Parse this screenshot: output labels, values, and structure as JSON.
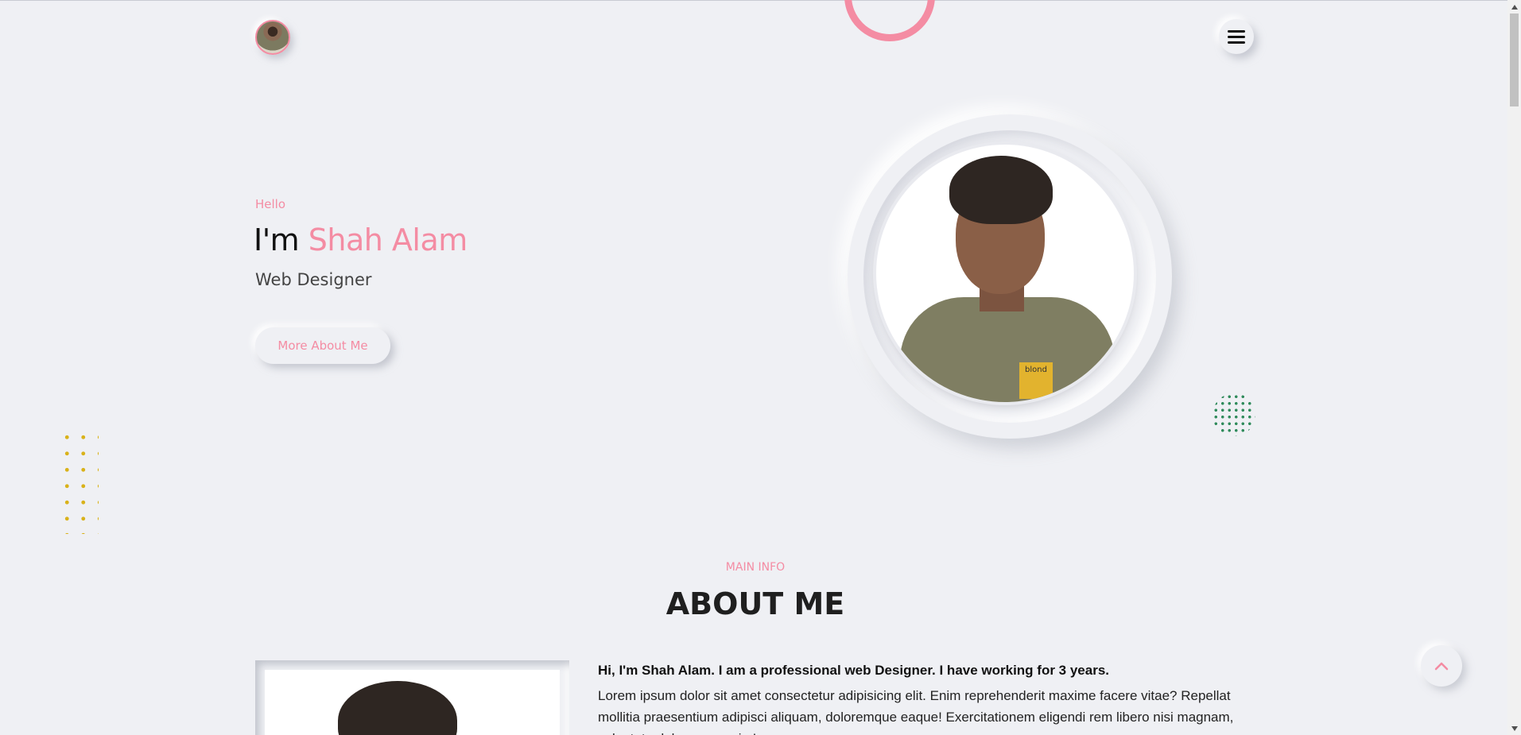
{
  "header": {
    "logo_icon": "avatar-icon",
    "menu_icon": "hamburger-icon"
  },
  "hero": {
    "greeting": "Hello",
    "headline_prefix": "I'm",
    "name": "Shah Alam",
    "role": "Web Designer",
    "cta_label": "More About Me",
    "photo_tag": "blond"
  },
  "about": {
    "kicker": "MAIN INFO",
    "title": "ABOUT ME",
    "lead": "Hi, I'm Shah Alam. I am a professional web Designer. I have working for 3 years.",
    "body": "Lorem ipsum dolor sit amet consectetur adipisicing elit. Enim reprehenderit maxime facere vitae? Repellat mollitia praesentium adipisci aliquam, doloremque eaque! Exercitationem eligendi rem libero nisi magnam, voluptate dolor quos enim!"
  },
  "colors": {
    "accent": "#f48ca3",
    "background": "#eff0f4",
    "dots_yellow": "#d9b21a",
    "dots_green": "#2e8a5a"
  },
  "scroll_top_icon": "chevron-up-icon"
}
